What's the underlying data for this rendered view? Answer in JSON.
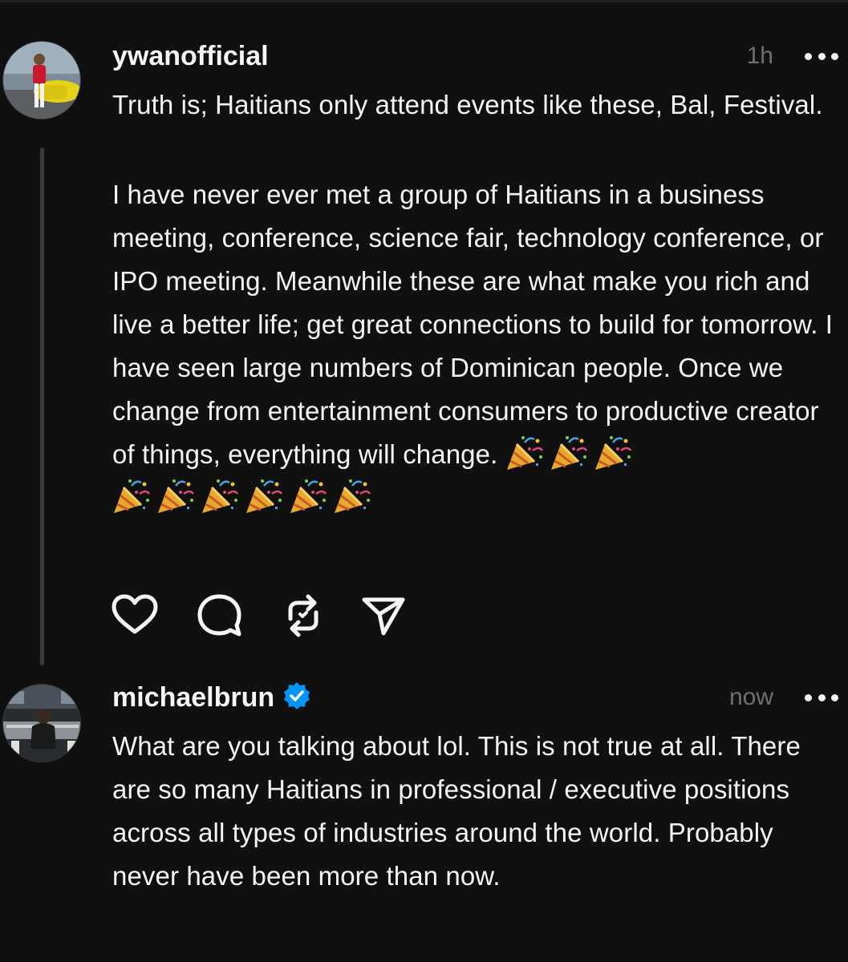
{
  "post": {
    "username": "ywanofficial",
    "time": "1h",
    "paragraphs": [
      "Truth is; Haitians only attend events like these, Bal, Festival.",
      "I have never ever met a group of Haitians in a business meeting, conference, science fair, technology conference, or IPO meeting. Meanwhile these are what make you rich and live a better life; get great connections to build for tomorrow. I have seen large numbers of Dominican people. Once we change from entertainment consumers to productive creator of things, everything will change."
    ],
    "emoji_icon": "party-popper-icon",
    "emoji_count": 9,
    "actions": [
      "heart-icon",
      "comment-icon",
      "repost-icon",
      "share-icon"
    ]
  },
  "reply": {
    "username": "michaelbrun",
    "verified": true,
    "time": "now",
    "text": "What are you talking about lol. This is not true at all. There are so many Haitians in professional / executive positions across all types of industries around the world. Probably never have been more than now."
  },
  "colors": {
    "background": "#101010",
    "text": "#f3f5f7",
    "secondary": "#6f6f6f",
    "verified": "#0095f6"
  }
}
